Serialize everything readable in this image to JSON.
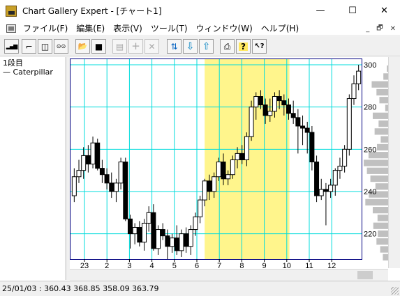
{
  "window": {
    "title": "Chart Gallery Expert - [チャート1]",
    "min_icon": "minimize-icon",
    "max_icon": "maximize-icon",
    "close_icon": "close-icon"
  },
  "menu": {
    "items": [
      "ファイル(F)",
      "編集(E)",
      "表示(V)",
      "ツール(T)",
      "ウィンドウ(W)",
      "ヘルプ(H)"
    ],
    "mdi_buttons": [
      "_",
      "🗗",
      "✕"
    ]
  },
  "toolbar": {
    "buttons": [
      {
        "name": "bar-chart-icon",
        "glyph": "▂▄▆",
        "enabled": true
      },
      {
        "name": "step-chart-icon",
        "glyph": "⌐",
        "enabled": true
      },
      {
        "name": "split-view-icon",
        "glyph": "◫",
        "enabled": true
      },
      {
        "name": "binoculars-icon",
        "glyph": "⊙⊙",
        "enabled": true
      },
      {
        "name": "open-folder-icon",
        "glyph": "📂",
        "enabled": true
      },
      {
        "name": "save-icon",
        "glyph": "■",
        "enabled": true
      },
      {
        "name": "properties-icon",
        "glyph": "▤",
        "enabled": false
      },
      {
        "name": "add-icon",
        "glyph": "+",
        "enabled": false
      },
      {
        "name": "delete-icon",
        "glyph": "✕",
        "enabled": false
      },
      {
        "name": "sort-icon",
        "glyph": "⇅",
        "enabled": true
      },
      {
        "name": "move-down-icon",
        "glyph": "⇩",
        "enabled": true
      },
      {
        "name": "move-up-icon",
        "glyph": "⇧",
        "enabled": true
      },
      {
        "name": "print-icon",
        "glyph": "⎙",
        "enabled": true
      },
      {
        "name": "help-icon",
        "glyph": "?",
        "enabled": true
      },
      {
        "name": "context-help-icon",
        "glyph": "↖?",
        "enabled": true
      }
    ]
  },
  "legend": {
    "section": "1段目",
    "series": "— Caterpillar"
  },
  "status": {
    "text": "25/01/03 : 360.43  368.85  358.09  363.79"
  },
  "colors": {
    "grid": "#00dcdc",
    "highlight": "#fff58c",
    "axis_frame": "#000080",
    "candle_down": "#000000",
    "candle_up": "#ffffff",
    "volume_profile": "#c0c0c0"
  },
  "chart_data": {
    "type": "candlestick",
    "ylim": [
      208,
      301
    ],
    "y_ticks": [
      "300",
      "280",
      "260",
      "240",
      "220"
    ],
    "x_ticks": [
      "23",
      "2",
      "3",
      "4",
      "5",
      "6",
      "7",
      "8",
      "9",
      "10",
      "11",
      "12"
    ],
    "highlight_x_ticks": [
      "7",
      "9"
    ],
    "candles": [
      [
        238,
        251,
        235,
        247
      ],
      [
        247,
        255,
        244,
        250
      ],
      [
        250,
        261,
        246,
        257
      ],
      [
        257,
        262,
        249,
        253
      ],
      [
        253,
        266,
        251,
        263
      ],
      [
        263,
        265,
        250,
        251
      ],
      [
        251,
        255,
        244,
        248
      ],
      [
        248,
        251,
        241,
        244
      ],
      [
        244,
        249,
        237,
        240
      ],
      [
        240,
        246,
        235,
        244
      ],
      [
        244,
        256,
        241,
        254
      ],
      [
        254,
        256,
        226,
        227
      ],
      [
        227,
        229,
        213,
        220
      ],
      [
        220,
        225,
        215,
        223
      ],
      [
        223,
        226,
        214,
        216
      ],
      [
        216,
        227,
        212,
        225
      ],
      [
        225,
        233,
        221,
        230
      ],
      [
        230,
        234,
        212,
        213
      ],
      [
        213,
        224,
        210,
        222
      ],
      [
        222,
        225,
        217,
        219
      ],
      [
        219,
        222,
        208,
        214
      ],
      [
        214,
        220,
        211,
        218
      ],
      [
        218,
        224,
        210,
        212
      ],
      [
        212,
        222,
        209,
        220
      ],
      [
        220,
        223,
        211,
        214
      ],
      [
        214,
        224,
        210,
        222
      ],
      [
        222,
        230,
        219,
        228
      ],
      [
        228,
        238,
        225,
        236
      ],
      [
        236,
        246,
        233,
        245
      ],
      [
        245,
        248,
        236,
        240
      ],
      [
        240,
        249,
        237,
        247
      ],
      [
        247,
        256,
        245,
        254
      ],
      [
        254,
        258,
        243,
        246
      ],
      [
        246,
        250,
        243,
        248
      ],
      [
        248,
        257,
        246,
        255
      ],
      [
        255,
        261,
        251,
        258
      ],
      [
        258,
        262,
        253,
        255
      ],
      [
        255,
        268,
        252,
        266
      ],
      [
        266,
        283,
        264,
        280
      ],
      [
        280,
        287,
        274,
        285
      ],
      [
        285,
        288,
        279,
        281
      ],
      [
        281,
        284,
        272,
        276
      ],
      [
        276,
        284,
        273,
        278
      ],
      [
        278,
        287,
        275,
        285
      ],
      [
        285,
        288,
        279,
        283
      ],
      [
        283,
        286,
        276,
        281
      ],
      [
        281,
        284,
        274,
        277
      ],
      [
        277,
        283,
        272,
        275
      ],
      [
        275,
        279,
        258,
        271
      ],
      [
        271,
        276,
        262,
        270
      ],
      [
        270,
        273,
        258,
        268
      ],
      [
        268,
        271,
        250,
        254
      ],
      [
        254,
        257,
        235,
        238
      ],
      [
        238,
        246,
        236,
        241
      ],
      [
        241,
        244,
        224,
        240
      ],
      [
        240,
        246,
        237,
        243
      ],
      [
        243,
        251,
        238,
        250
      ],
      [
        250,
        256,
        246,
        252
      ],
      [
        252,
        262,
        249,
        260
      ],
      [
        260,
        286,
        257,
        284
      ],
      [
        284,
        295,
        281,
        291
      ],
      [
        291,
        300,
        288,
        297
      ]
    ],
    "volume_profile": [
      0.05,
      0.18,
      0.62,
      0.44,
      0.33,
      0.11,
      0.58,
      0.36,
      0.51,
      0.28,
      0.42,
      0.74,
      0.92,
      0.8,
      0.67,
      0.48,
      0.73,
      0.86,
      0.58,
      0.4,
      0.56,
      0.39,
      0.44,
      0.3,
      0.2
    ]
  }
}
